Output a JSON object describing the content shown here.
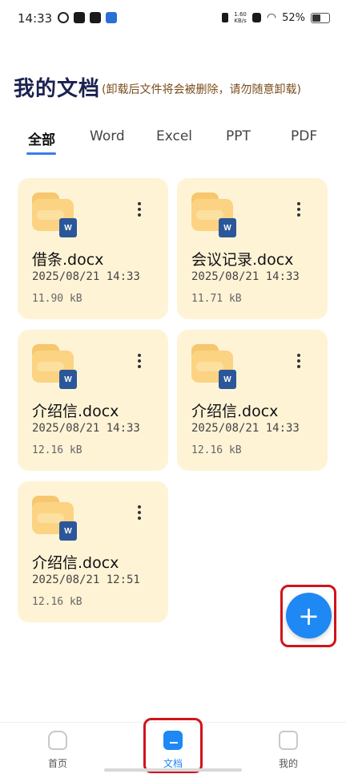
{
  "status_bar": {
    "time": "14:33",
    "speed_value": "1.60",
    "speed_unit": "KB/s",
    "battery": "52%"
  },
  "header": {
    "title": "我的文档",
    "subtitle": "(卸载后文件将会被删除，请勿随意卸载)"
  },
  "tabs": [
    {
      "label": "全部",
      "active": true
    },
    {
      "label": "Word"
    },
    {
      "label": "Excel"
    },
    {
      "label": "PPT"
    },
    {
      "label": "PDF"
    }
  ],
  "files": [
    {
      "name": "借条.docx",
      "date": "2025/08/21 14:33",
      "size": "11.90 kB",
      "type_badge": "W"
    },
    {
      "name": "会议记录.docx",
      "date": "2025/08/21 14:33",
      "size": "11.71 kB",
      "type_badge": "W"
    },
    {
      "name": "介绍信.docx",
      "date": "2025/08/21 14:33",
      "size": "12.16 kB",
      "type_badge": "W"
    },
    {
      "name": "介绍信.docx",
      "date": "2025/08/21 14:33",
      "size": "12.16 kB",
      "type_badge": "W"
    },
    {
      "name": "介绍信.docx",
      "date": "2025/08/21 12:51",
      "size": "12.16 kB",
      "type_badge": "W"
    }
  ],
  "fab": {
    "label": "+",
    "icon": "plus-icon"
  },
  "bottom_nav": [
    {
      "label": "首页",
      "icon": "home-icon"
    },
    {
      "label": "文档",
      "icon": "document-folder-icon",
      "active": true
    },
    {
      "label": "我的",
      "icon": "profile-icon"
    }
  ],
  "colors": {
    "accent": "#1e88f4",
    "card_bg": "#fff3d6",
    "highlight": "#d0141c",
    "title": "#1b2150"
  }
}
